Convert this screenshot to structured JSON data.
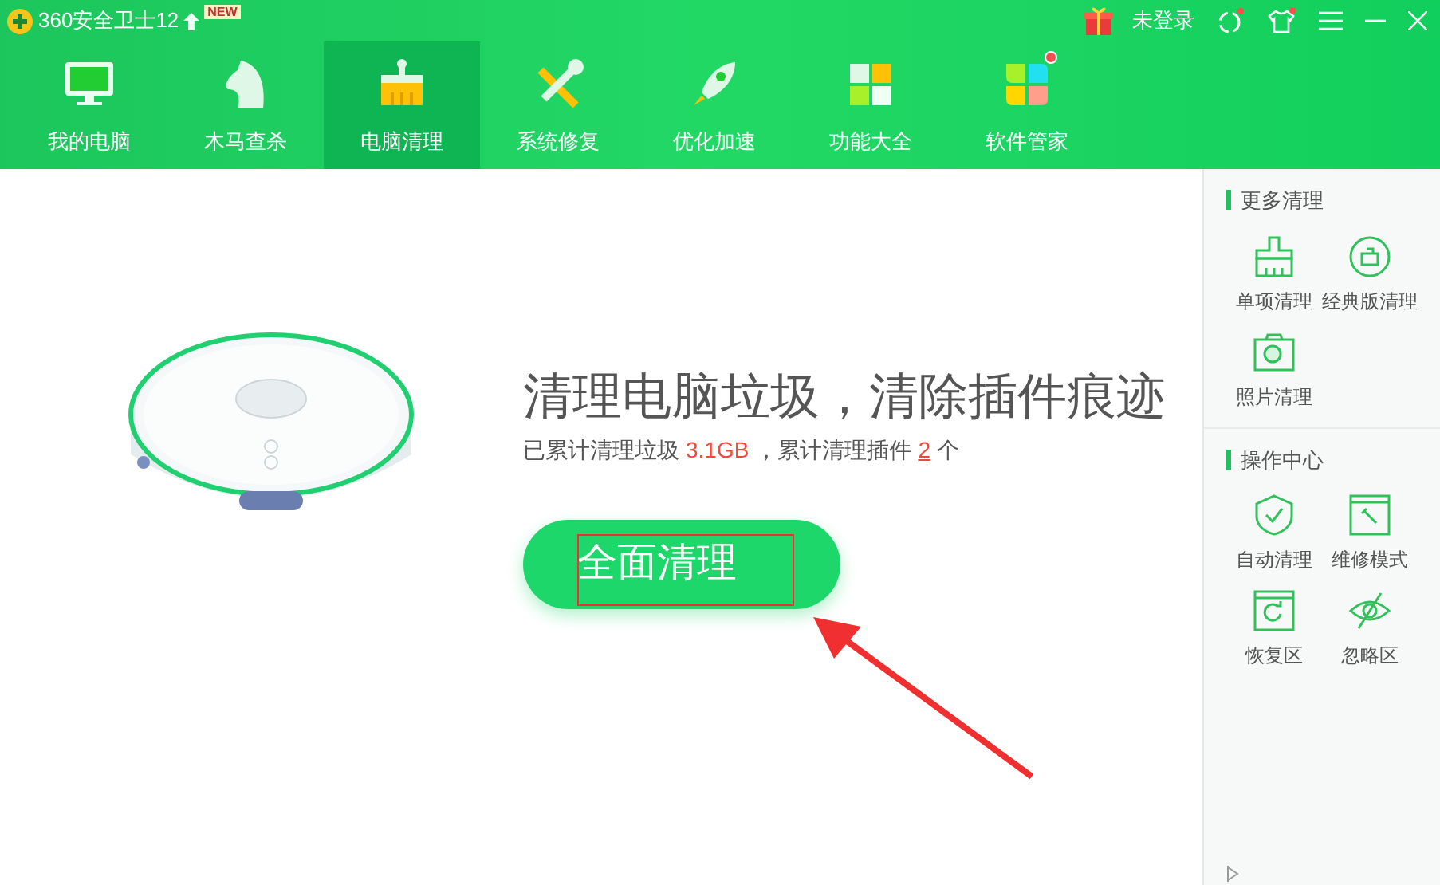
{
  "app": {
    "title": "360安全卫士12",
    "badge": "NEW",
    "login": "未登录"
  },
  "nav": [
    {
      "label": "我的电脑",
      "selected": false,
      "dot": false
    },
    {
      "label": "木马查杀",
      "selected": false,
      "dot": false
    },
    {
      "label": "电脑清理",
      "selected": true,
      "dot": false
    },
    {
      "label": "系统修复",
      "selected": false,
      "dot": false
    },
    {
      "label": "优化加速",
      "selected": false,
      "dot": false
    },
    {
      "label": "功能大全",
      "selected": false,
      "dot": false
    },
    {
      "label": "软件管家",
      "selected": false,
      "dot": true
    }
  ],
  "main": {
    "headline": "清理电脑垃圾，清除插件痕迹",
    "stats_prefix": "已累计清理垃圾",
    "junk_size": "3.1GB",
    "stats_middle": "，累计清理插件",
    "plugin_count": "2",
    "stats_suffix": "个",
    "button": "全面清理"
  },
  "sidebar": [
    {
      "title": "更多清理",
      "items": [
        "单项清理",
        "经典版清理",
        "照片清理"
      ]
    },
    {
      "title": "操作中心",
      "items": [
        "自动清理",
        "维修模式",
        "恢复区",
        "忽略区"
      ]
    }
  ]
}
